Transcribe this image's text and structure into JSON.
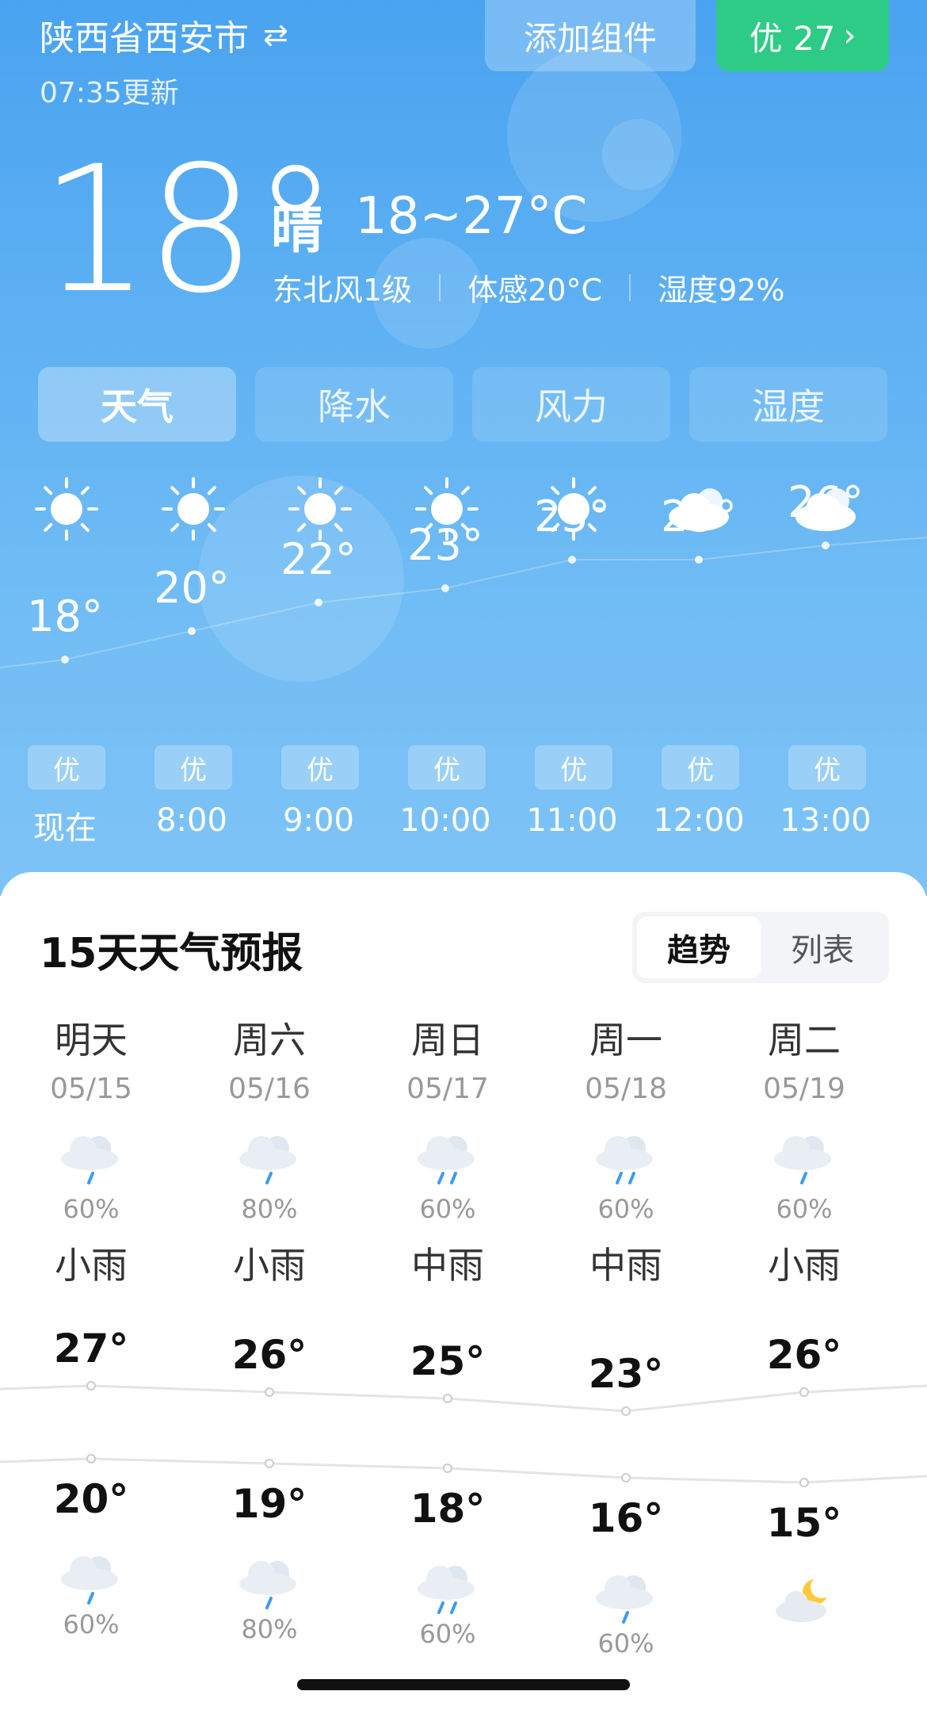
{
  "header": {
    "location": "陕西省西安市",
    "updated": "07:35更新",
    "add_widget": "添加组件",
    "aqi_label": "优 27"
  },
  "current": {
    "temp": "18°",
    "condition": "晴",
    "range": "18~27°C",
    "wind": "东北风1级",
    "feels_like": "体感20°C",
    "humidity": "湿度92%"
  },
  "tabs": [
    "天气",
    "降水",
    "风力",
    "湿度"
  ],
  "hourly": [
    {
      "time": "现在",
      "temp": "18°",
      "icon": "sun-icon",
      "aqi": "优",
      "t": 18
    },
    {
      "time": "8:00",
      "temp": "20°",
      "icon": "sun-icon",
      "aqi": "优",
      "t": 20
    },
    {
      "time": "9:00",
      "temp": "22°",
      "icon": "sun-icon",
      "aqi": "优",
      "t": 22
    },
    {
      "time": "10:00",
      "temp": "23°",
      "icon": "sun-icon",
      "aqi": "优",
      "t": 23
    },
    {
      "time": "11:00",
      "temp": "25°",
      "icon": "sun-icon",
      "aqi": "优",
      "t": 25
    },
    {
      "time": "12:00",
      "temp": "25°",
      "icon": "cloud-icon",
      "aqi": "优",
      "t": 25
    },
    {
      "time": "13:00",
      "temp": "26°",
      "icon": "cloud-icon",
      "aqi": "优",
      "t": 26
    }
  ],
  "forecast": {
    "title": "15天天气预报",
    "seg_trend": "趋势",
    "seg_list": "列表",
    "days": [
      {
        "name": "明天",
        "date": "05/15",
        "pct": "60%",
        "cond": "小雨",
        "hi": "27°",
        "lo": "20°",
        "h": 27,
        "l": 20,
        "icon": "light-rain-icon",
        "night_pct": "60%",
        "night_icon": "light-rain-icon"
      },
      {
        "name": "周六",
        "date": "05/16",
        "pct": "80%",
        "cond": "小雨",
        "hi": "26°",
        "lo": "19°",
        "h": 26,
        "l": 19,
        "icon": "light-rain-icon",
        "night_pct": "80%",
        "night_icon": "light-rain-icon"
      },
      {
        "name": "周日",
        "date": "05/17",
        "pct": "60%",
        "cond": "中雨",
        "hi": "25°",
        "lo": "18°",
        "h": 25,
        "l": 18,
        "icon": "moderate-rain-icon",
        "night_pct": "60%",
        "night_icon": "moderate-rain-icon"
      },
      {
        "name": "周一",
        "date": "05/18",
        "pct": "60%",
        "cond": "中雨",
        "hi": "23°",
        "lo": "16°",
        "h": 23,
        "l": 16,
        "icon": "moderate-rain-icon",
        "night_pct": "60%",
        "night_icon": "light-rain-icon"
      },
      {
        "name": "周二",
        "date": "05/19",
        "pct": "60%",
        "cond": "小雨",
        "hi": "26°",
        "lo": "15°",
        "h": 26,
        "l": 15,
        "icon": "light-rain-icon",
        "night_pct": "",
        "night_icon": "moon-cloud-icon"
      }
    ]
  },
  "colors": {
    "aqi_green": "#2ecb86",
    "sky": "#5db0f3",
    "rain": "#3d9bf0"
  }
}
